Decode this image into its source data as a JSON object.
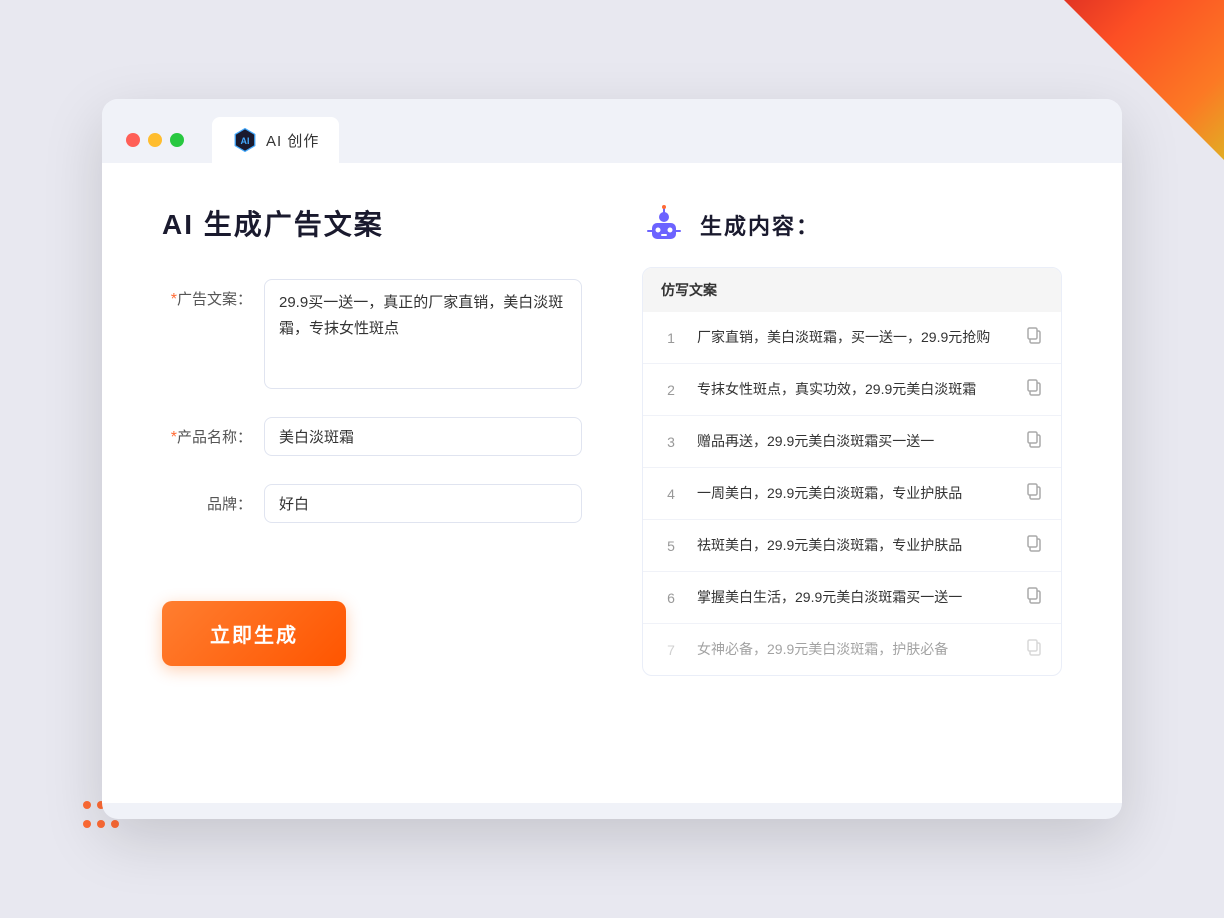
{
  "decorative": {
    "dots": [
      "dot1",
      "dot2",
      "dot3",
      "dot4",
      "dot5",
      "dot6"
    ]
  },
  "browser": {
    "tab_label": "AI 创作"
  },
  "left_panel": {
    "title": "AI 生成广告文案",
    "form": {
      "ad_copy_label": "广告文案：",
      "ad_copy_required": "*",
      "ad_copy_value": "29.9买一送一，真正的厂家直销，美白淡斑霜，专抹女性斑点",
      "product_name_label": "产品名称：",
      "product_name_required": "*",
      "product_name_value": "美白淡斑霜",
      "brand_label": "品牌：",
      "brand_value": "好白"
    },
    "generate_button": "立即生成"
  },
  "right_panel": {
    "title": "生成内容：",
    "table_header": "仿写文案",
    "results": [
      {
        "num": "1",
        "text": "厂家直销，美白淡斑霜，买一送一，29.9元抢购",
        "faded": false
      },
      {
        "num": "2",
        "text": "专抹女性斑点，真实功效，29.9元美白淡斑霜",
        "faded": false
      },
      {
        "num": "3",
        "text": "赠品再送，29.9元美白淡斑霜买一送一",
        "faded": false
      },
      {
        "num": "4",
        "text": "一周美白，29.9元美白淡斑霜，专业护肤品",
        "faded": false
      },
      {
        "num": "5",
        "text": "祛斑美白，29.9元美白淡斑霜，专业护肤品",
        "faded": false
      },
      {
        "num": "6",
        "text": "掌握美白生活，29.9元美白淡斑霜买一送一",
        "faded": false
      },
      {
        "num": "7",
        "text": "女神必备，29.9元美白淡斑霜，护肤必备",
        "faded": true
      }
    ]
  }
}
